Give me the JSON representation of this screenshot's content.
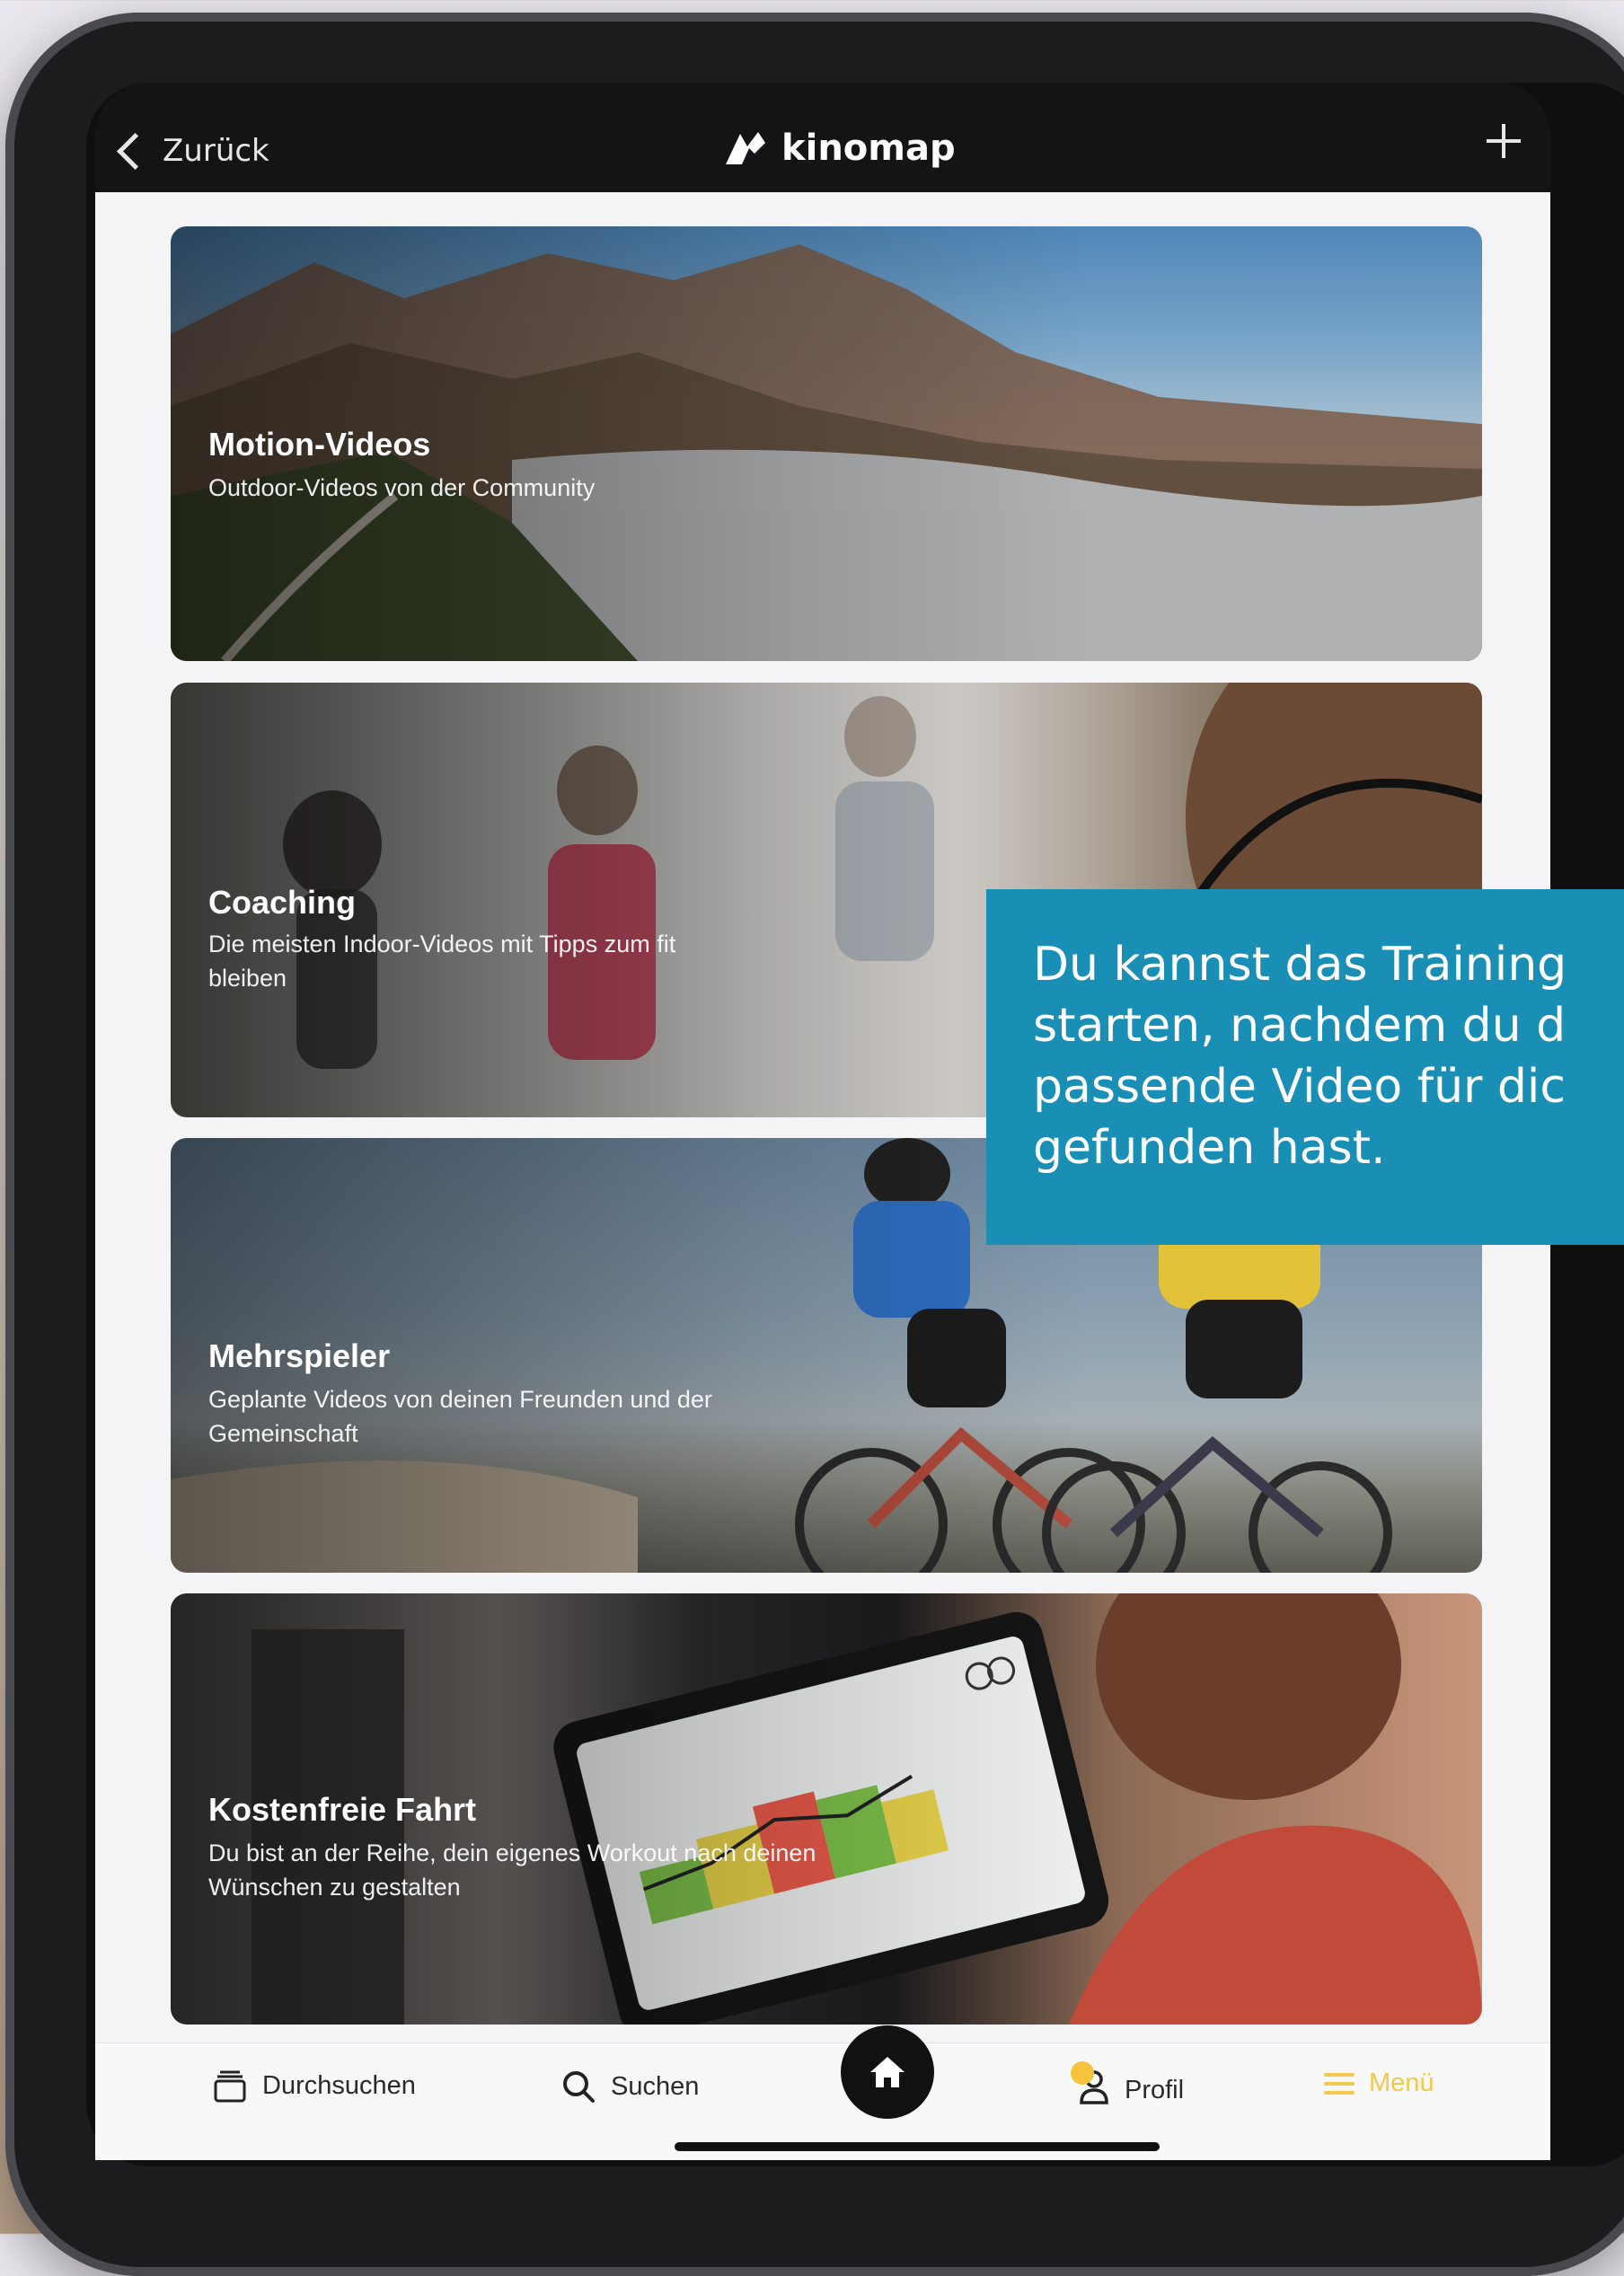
{
  "header": {
    "back_label": "Zurück",
    "brand": "kinomap"
  },
  "cards": [
    {
      "title": "Motion-Videos",
      "subtitle": "Outdoor-Videos von der Community"
    },
    {
      "title": "Coaching",
      "subtitle": "Die meisten Indoor-Videos mit Tipps zum fit bleiben"
    },
    {
      "title": "Mehrspieler",
      "subtitle": "Geplante Videos von deinen Freunden und der Gemeinschaft"
    },
    {
      "title": "Kostenfreie Fahrt",
      "subtitle": "Du bist an der Reihe, dein eigenes Workout nach deinen Wünschen zu gestalten"
    }
  ],
  "tooltip": {
    "lines": [
      "Du kannst das Training",
      "starten, nachdem du d",
      "passende Video für dic",
      "gefunden hast."
    ]
  },
  "tabbar": {
    "browse": "Durchsuchen",
    "search": "Suchen",
    "profile": "Profil",
    "menu": "Menü"
  },
  "colors": {
    "tooltip_bg": "#1a8fb6",
    "menu_accent": "#f2c94c",
    "profile_badge": "#f6c43a"
  }
}
